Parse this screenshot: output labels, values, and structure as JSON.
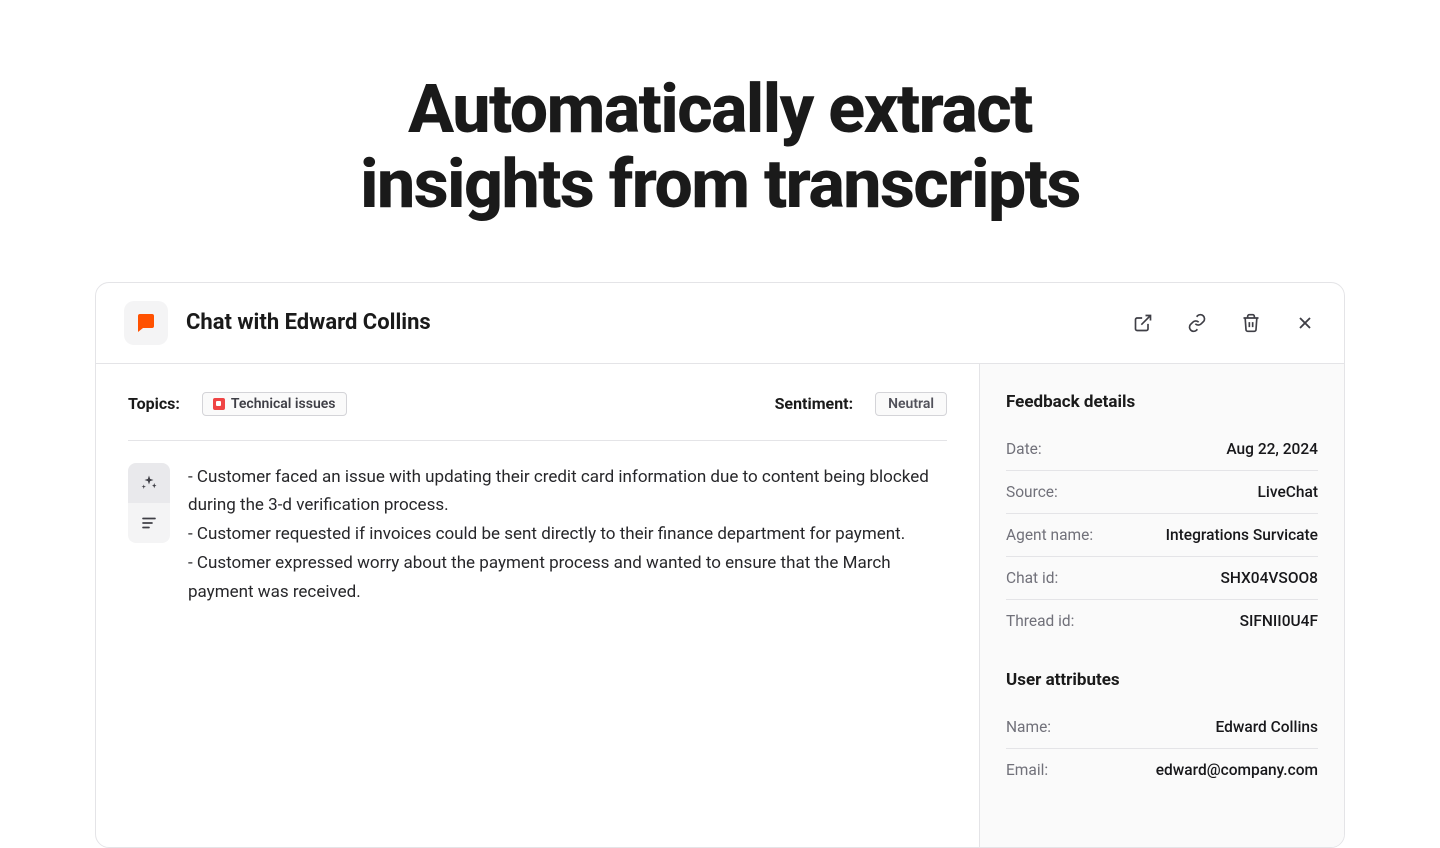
{
  "hero": {
    "line1": "Automatically extract",
    "line2": "insights from transcripts"
  },
  "header": {
    "title": "Chat with Edward Collins"
  },
  "meta": {
    "topics_label": "Topics:",
    "topic_tag": "Technical issues",
    "sentiment_label": "Sentiment:",
    "sentiment_value": "Neutral"
  },
  "summary": {
    "line1": "- Customer faced an issue with updating their credit card information due to content being blocked during the 3-d verification process.",
    "line2": "- Customer requested if invoices could be sent directly to their finance department for payment.",
    "line3": "- Customer expressed worry about the payment process and wanted to ensure that the March payment was received."
  },
  "details": {
    "heading": "Feedback details",
    "rows": {
      "date_k": "Date:",
      "date_v": "Aug 22, 2024",
      "source_k": "Source:",
      "source_v": "LiveChat",
      "agent_k": "Agent name:",
      "agent_v": "Integrations Survicate",
      "chatid_k": "Chat id:",
      "chatid_v": "SHX04VSOO8",
      "threadid_k": "Thread id:",
      "threadid_v": "SIFNII0U4F"
    }
  },
  "user_attrs": {
    "heading": "User attributes",
    "name_k": "Name:",
    "name_v": "Edward Collins",
    "email_k": "Email:",
    "email_v": "edward@company.com"
  }
}
